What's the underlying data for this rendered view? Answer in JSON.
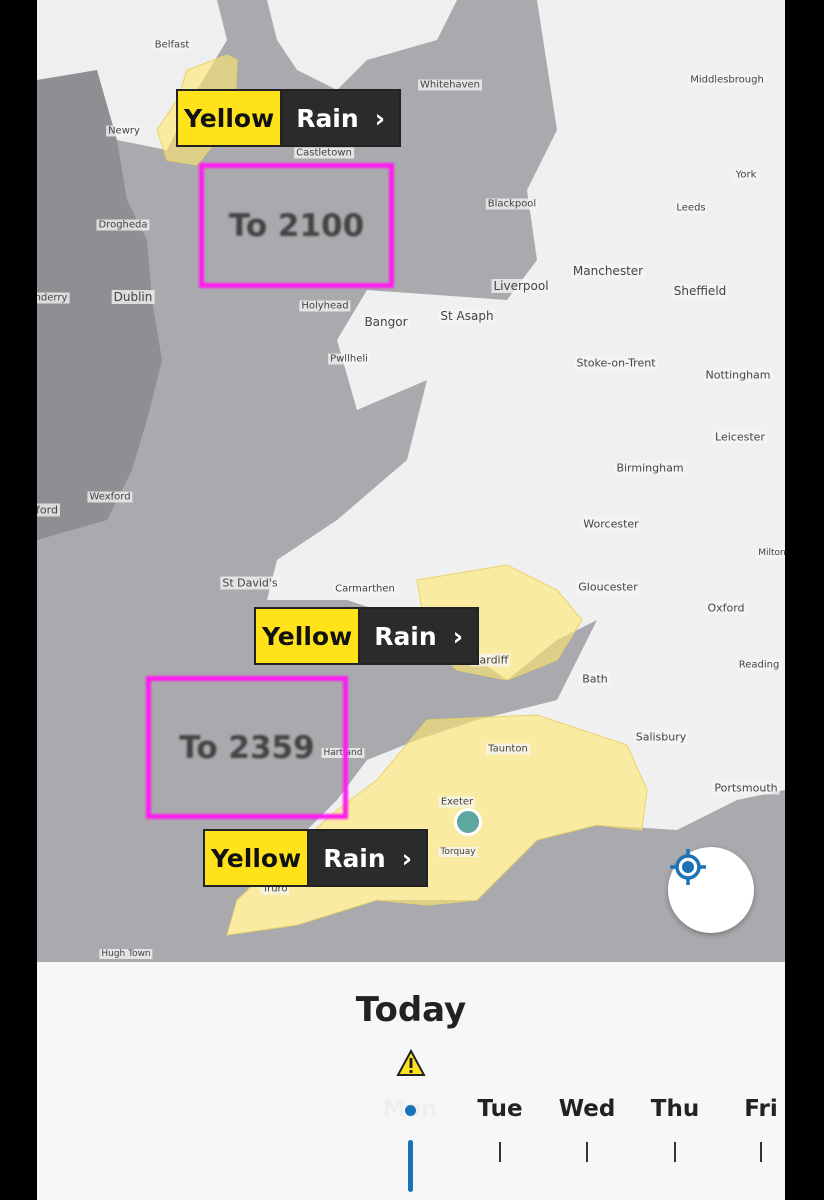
{
  "places": [
    "Belfast",
    "Newry",
    "Whitehaven",
    "Middlesbrough",
    "Castletown",
    "York",
    "Blackpool",
    "Leeds",
    "Drogheda",
    "Dublin",
    "Liverpool",
    "Manchester",
    "Sheffield",
    "Holyhead",
    "Bangor",
    "St Asaph",
    "Stoke-on-Trent",
    "Nottingham",
    "Pwllheli",
    "Leicester",
    "Birmingham",
    "Wexford",
    "Worcester",
    "St David's",
    "Carmarthen",
    "Gloucester",
    "Oxford",
    "Cardiff",
    "Bath",
    "Reading",
    "Taunton",
    "Salisbury",
    "Portsmouth",
    "Exeter",
    "Torquay",
    "Truro",
    "Hugh Town",
    "Hartland",
    "nderry",
    "ford",
    "Milton"
  ],
  "warnings": [
    {
      "level": "Yellow",
      "type": "Rain",
      "until": "To 2100"
    },
    {
      "level": "Yellow",
      "type": "Rain",
      "until": "To 2359"
    },
    {
      "level": "Yellow",
      "type": "Rain"
    }
  ],
  "colors": {
    "warning_yellow": "#ffe21a",
    "highlight": "#ff1cf0",
    "accent": "#1a73b5"
  },
  "timeline": {
    "title": "Today",
    "days": [
      "Mon",
      "Tue",
      "Wed",
      "Thu",
      "Fri"
    ],
    "selected": "Mon"
  },
  "icons": {
    "warning": "warning-triangle-icon",
    "location": "my-location-icon",
    "chevron": "chevron-right-icon"
  }
}
